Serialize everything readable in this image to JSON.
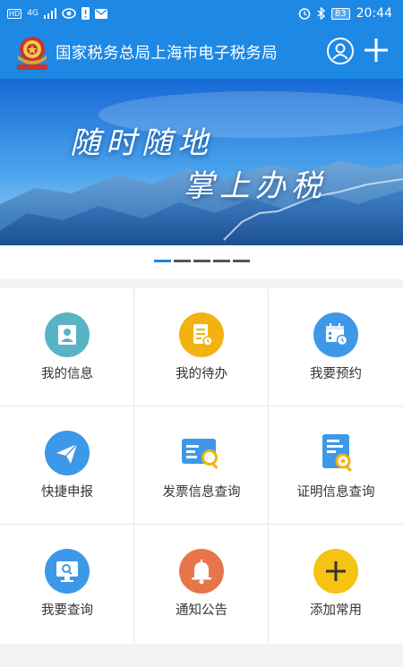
{
  "status_bar": {
    "left_badges": [
      "HD",
      "4G"
    ],
    "battery": "83",
    "time": "20:44"
  },
  "app_bar": {
    "title": "国家税务总局上海市电子税务局"
  },
  "banner": {
    "line1": "随时随地",
    "line2": "掌上办税"
  },
  "grid": [
    {
      "label": "我的信息",
      "icon": "person-icon",
      "color": "#58b3c4"
    },
    {
      "label": "我的待办",
      "icon": "todo-icon",
      "color": "#f2b211"
    },
    {
      "label": "我要预约",
      "icon": "calendar-clock-icon",
      "color": "#3d98e8"
    },
    {
      "label": "快捷申报",
      "icon": "paper-plane-icon",
      "color": "#3d98e8"
    },
    {
      "label": "发票信息查询",
      "icon": "invoice-search-icon",
      "color": "#3d98e8"
    },
    {
      "label": "证明信息查询",
      "icon": "certificate-search-icon",
      "color": "#3d98e8"
    },
    {
      "label": "我要查询",
      "icon": "monitor-search-icon",
      "color": "#3d98e8"
    },
    {
      "label": "通知公告",
      "icon": "bell-icon",
      "color": "#e8754a"
    },
    {
      "label": "添加常用",
      "icon": "add-icon",
      "color": "#f5c311"
    }
  ]
}
